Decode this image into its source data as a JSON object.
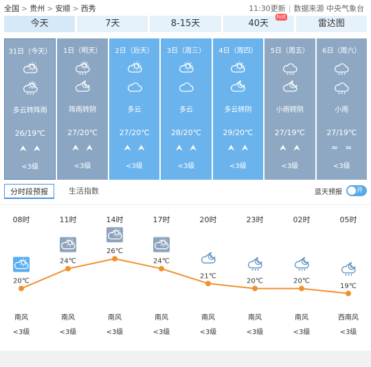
{
  "breadcrumb": [
    "全国",
    "贵州",
    "安顺",
    "西秀"
  ],
  "breadcrumb_sep": ">",
  "update_time": "11:30更新",
  "source": "数据来源 中央气象台",
  "tabs": [
    {
      "label": "今天"
    },
    {
      "label": "7天"
    },
    {
      "label": "8-15天"
    },
    {
      "label": "40天",
      "badge": "hot"
    },
    {
      "label": "雷达图"
    }
  ],
  "days": [
    {
      "date": "31日（今天）",
      "icon_day": "partly-cloudy-icon",
      "icon_night": "showers-icon",
      "condition": "多云转阵雨",
      "temp": "26/19℃",
      "wind": "up-arrows",
      "level": "<3级"
    },
    {
      "date": "1日（明天）",
      "icon_day": "showers-icon",
      "icon_night": "cloudy-night-icon",
      "condition": "阵雨转阴",
      "temp": "27/20℃",
      "wind": "up-arrows",
      "level": "<3级"
    },
    {
      "date": "2日（后天）",
      "icon_day": "partly-cloudy-icon",
      "icon_night": "cloudy-icon",
      "condition": "多云",
      "temp": "27/20℃",
      "wind": "up-arrows",
      "level": "<3级"
    },
    {
      "date": "3日（周三）",
      "icon_day": "partly-cloudy-icon",
      "icon_night": "cloudy-icon",
      "condition": "多云",
      "temp": "28/20℃",
      "wind": "up-arrows",
      "level": "<3级"
    },
    {
      "date": "4日（周四）",
      "icon_day": "partly-cloudy-icon",
      "icon_night": "cloudy-night-icon",
      "condition": "多云转阴",
      "temp": "29/20℃",
      "wind": "up-arrows",
      "level": "<3级"
    },
    {
      "date": "5日（周五）",
      "icon_day": "rain-icon",
      "icon_night": "cloudy-night-icon",
      "condition": "小雨转阴",
      "temp": "27/19℃",
      "wind": "up-arrows",
      "level": "<3级"
    },
    {
      "date": "6日（周六）",
      "icon_day": "rain-icon",
      "icon_night": "rain-icon",
      "condition": "小雨",
      "temp": "27/19℃",
      "wind": "wave-icons",
      "level": "<3级"
    }
  ],
  "subtabs": [
    "分时段预报",
    "生活指数"
  ],
  "bluesky": {
    "label": "蓝天预报",
    "toggle": "开"
  },
  "hourly": [
    {
      "time": "08时",
      "temp": 20,
      "temp_label": "20℃",
      "dir": "南风",
      "level": "<3级",
      "icon": "partly-cloudy-icon"
    },
    {
      "time": "11时",
      "temp": 24,
      "temp_label": "24℃",
      "dir": "南风",
      "level": "<3级",
      "icon": "cloudy-box-icon"
    },
    {
      "time": "14时",
      "temp": 26,
      "temp_label": "26℃",
      "dir": "南风",
      "level": "<3级",
      "icon": "cloudy-box-icon"
    },
    {
      "time": "17时",
      "temp": 24,
      "temp_label": "24℃",
      "dir": "南风",
      "level": "<3级",
      "icon": "cloudy-box-icon"
    },
    {
      "time": "20时",
      "temp": 21,
      "temp_label": "21℃",
      "dir": "南风",
      "level": "<3级",
      "icon": "cloudy-night-icon"
    },
    {
      "time": "23时",
      "temp": 20,
      "temp_label": "20℃",
      "dir": "南风",
      "level": "<3级",
      "icon": "showers-night-icon"
    },
    {
      "time": "02时",
      "temp": 20,
      "temp_label": "20℃",
      "dir": "南风",
      "level": "<3级",
      "icon": "showers-night-icon"
    },
    {
      "time": "05时",
      "temp": 19,
      "temp_label": "19℃",
      "dir": "西南风",
      "level": "<3级",
      "icon": "showers-night-icon"
    }
  ],
  "colors": {
    "line": "#f0902e",
    "accent": "#4a90e2"
  }
}
